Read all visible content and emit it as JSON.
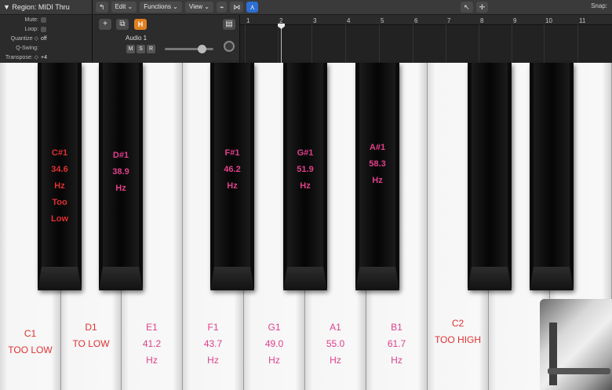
{
  "inspector": {
    "region_label": "▼ Region: MIDI Thru",
    "rows": [
      {
        "label": "Mute:",
        "value": ""
      },
      {
        "label": "Loop:",
        "value": ""
      },
      {
        "label": "Quantize ◇",
        "value": "off"
      },
      {
        "label": "Q-Swing:",
        "value": ""
      },
      {
        "label": "Transpose: ◇",
        "value": "+4"
      }
    ]
  },
  "toolbar": {
    "back_icon": "↰",
    "edit_label": "Edit ⌄",
    "functions_label": "Functions ⌄",
    "view_label": "View ⌄",
    "snap_label": "Snap:"
  },
  "track": {
    "add_label": "+",
    "h_label": "H",
    "name": "Audio 1",
    "m_label": "M",
    "s_label": "S",
    "r_label": "R"
  },
  "ruler": {
    "bars": [
      "1",
      "2",
      "3",
      "4",
      "5",
      "6",
      "7",
      "8",
      "9",
      "10",
      "11"
    ]
  },
  "keys": {
    "white": [
      {
        "lines": [
          "C1",
          "TOO LOW"
        ],
        "color": "red"
      },
      {
        "lines": [
          "D1",
          "TO LOW"
        ],
        "color": "red"
      },
      {
        "lines": [
          "E1",
          "41.2",
          "Hz"
        ],
        "color": "pink"
      },
      {
        "lines": [
          "F1",
          "43.7",
          "Hz"
        ],
        "color": "pink"
      },
      {
        "lines": [
          "G1",
          "49.0",
          "Hz"
        ],
        "color": "pink"
      },
      {
        "lines": [
          "A1",
          "55.0",
          "Hz"
        ],
        "color": "pink"
      },
      {
        "lines": [
          "B1",
          "61.7",
          "Hz"
        ],
        "color": "pink"
      },
      {
        "lines": [
          "C2",
          "TOO HIGH"
        ],
        "color": "red"
      },
      {
        "lines": [],
        "color": "pink"
      },
      {
        "lines": [],
        "color": "pink"
      }
    ],
    "black": [
      {
        "lines": [
          "C#1",
          "34.6",
          "Hz",
          "Too",
          "Low"
        ],
        "color": "red"
      },
      {
        "lines": [
          "D#1",
          "38.9",
          "Hz"
        ],
        "color": "pink"
      },
      {
        "lines": [
          "F#1",
          "46.2",
          "Hz"
        ],
        "color": "pink"
      },
      {
        "lines": [
          "G#1",
          "51.9",
          "Hz"
        ],
        "color": "pink"
      },
      {
        "lines": [
          "A#1",
          "58.3",
          "Hz"
        ],
        "color": "pink"
      },
      {
        "lines": [],
        "color": "pink"
      },
      {
        "lines": [],
        "color": "pink"
      }
    ]
  },
  "colors": {
    "label_pink": "#e0408a",
    "label_red": "#e03030"
  }
}
